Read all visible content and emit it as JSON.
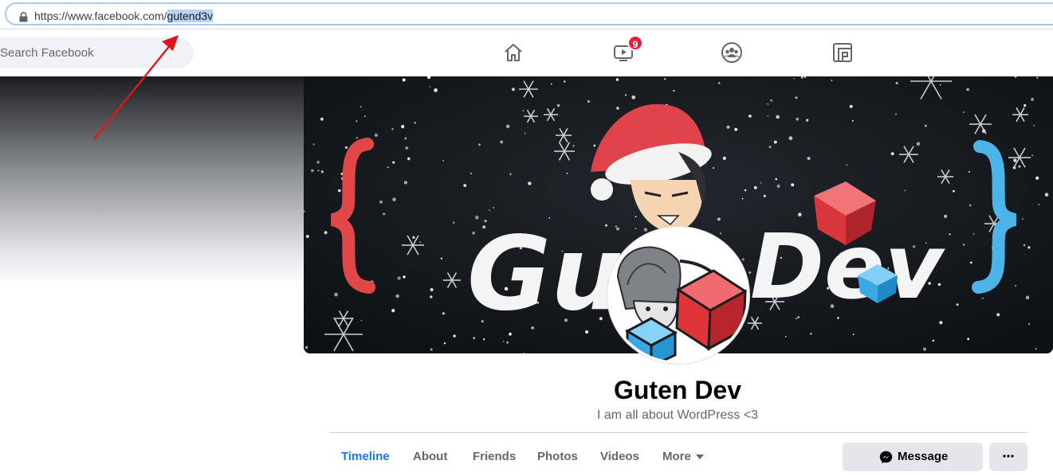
{
  "browser": {
    "url_host": "https://www.facebook.com/",
    "url_path": "gutend3v"
  },
  "header": {
    "search_placeholder": "Search Facebook",
    "watch_badge_count": "9",
    "nav_icons": [
      "home-icon",
      "watch-icon",
      "groups-icon",
      "gaming-icon"
    ]
  },
  "cover": {
    "brand_text": "GutenDev"
  },
  "profile": {
    "name": "Guten Dev",
    "bio": "I am all about WordPress <3"
  },
  "tabs": [
    {
      "label": "Timeline",
      "active": true
    },
    {
      "label": "About",
      "active": false
    },
    {
      "label": "Friends",
      "active": false
    },
    {
      "label": "Photos",
      "active": false
    },
    {
      "label": "Videos",
      "active": false
    },
    {
      "label": "More",
      "active": false
    }
  ],
  "actions": {
    "message_label": "Message"
  },
  "colors": {
    "accent": "#1877f2",
    "badge": "#e41e3f",
    "annotation_arrow": "#e0161b",
    "url_highlight": "#b6d2f6"
  }
}
